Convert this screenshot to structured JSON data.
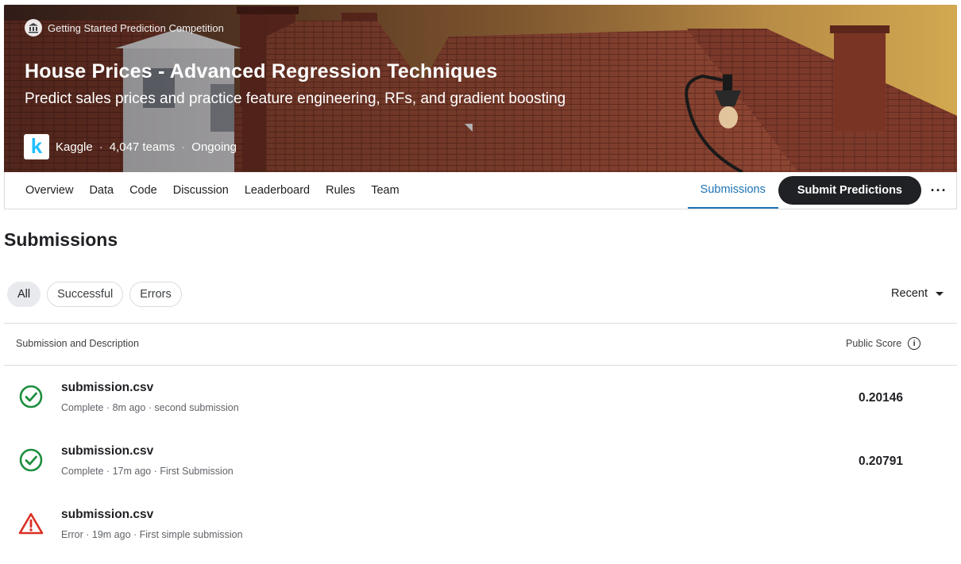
{
  "hero": {
    "competition_type": "Getting Started Prediction Competition",
    "title": "House Prices - Advanced Regression Techniques",
    "subtitle": "Predict sales prices and practice feature engineering, RFs, and gradient boosting",
    "host_logo_letter": "k",
    "host": "Kaggle",
    "teams": "4,047 teams",
    "status": "Ongoing",
    "separator": "·"
  },
  "nav": {
    "tabs": [
      "Overview",
      "Data",
      "Code",
      "Discussion",
      "Leaderboard",
      "Rules",
      "Team"
    ],
    "active_tab": "Submissions",
    "submit_label": "Submit Predictions",
    "more_label": "···"
  },
  "page": {
    "title": "Submissions"
  },
  "filters": {
    "chips": [
      "All",
      "Successful",
      "Errors"
    ],
    "active": "All",
    "sort_label": "Recent"
  },
  "table": {
    "col_submission": "Submission and Description",
    "col_score": "Public Score",
    "rows": [
      {
        "status": "complete",
        "file": "submission.csv",
        "description": "Complete · 8m ago · second submission",
        "score": "0.20146"
      },
      {
        "status": "complete",
        "file": "submission.csv",
        "description": "Complete · 17m ago · First Submission",
        "score": "0.20791"
      },
      {
        "status": "error",
        "file": "submission.csv",
        "description": "Error · 19m ago · First simple submission",
        "score": ""
      }
    ]
  },
  "colors": {
    "success": "#1e8e3e",
    "error": "#d93025",
    "active_tab": "#1c73b5",
    "submit_bg": "#202124",
    "kaggle_blue": "#20beff"
  },
  "icons": {
    "competition_type": "bank-icon",
    "info": "info-icon",
    "success": "check-circle-icon",
    "error": "warning-triangle-icon",
    "sort": "caret-down-icon"
  }
}
